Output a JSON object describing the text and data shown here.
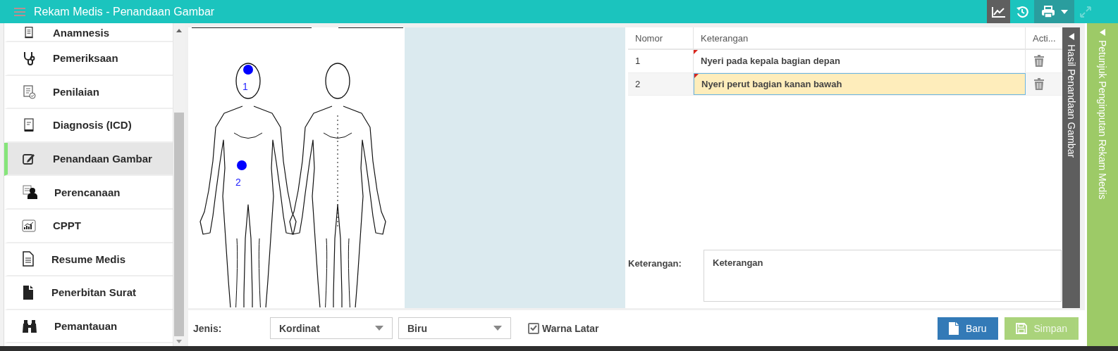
{
  "header": {
    "title": "Rekam Medis - Penandaan Gambar",
    "toolbar": [
      {
        "kind": "chart",
        "selected": true,
        "disabled": false
      },
      {
        "kind": "history",
        "selected": false,
        "disabled": false
      },
      {
        "kind": "print",
        "selected": false,
        "disabled": false
      },
      {
        "kind": "expand",
        "selected": false,
        "disabled": true
      }
    ]
  },
  "sidebar": {
    "items": [
      {
        "label": "Anamnesis",
        "selected": false
      },
      {
        "label": "Pemeriksaan",
        "selected": false
      },
      {
        "label": "Penilaian",
        "selected": false
      },
      {
        "label": "Diagnosis (ICD)",
        "selected": false
      },
      {
        "label": "Penandaan Gambar",
        "selected": true
      },
      {
        "label": "Perencanaan",
        "selected": false
      },
      {
        "label": "CPPT",
        "selected": false
      },
      {
        "label": "Resume Medis",
        "selected": false
      },
      {
        "label": "Penerbitan Surat",
        "selected": false
      },
      {
        "label": "Pemantauan",
        "selected": false
      }
    ]
  },
  "diagram": {
    "markers": [
      {
        "label": "1"
      },
      {
        "label": "2"
      }
    ]
  },
  "table": {
    "columns": [
      "Nomor",
      "Keterangan",
      "Acti..."
    ],
    "rows": [
      {
        "nomor": "1",
        "keterangan": "Nyeri pada kepala bagian depan",
        "modified": true,
        "selected": false
      },
      {
        "nomor": "2",
        "keterangan": "Nyeri perut bagian kanan bawah",
        "modified": true,
        "selected": true
      }
    ]
  },
  "note": {
    "label": "Keterangan:",
    "placeholder": "Keterangan"
  },
  "side_tabs": [
    {
      "label": "Hasil Penandaan Gambar",
      "kind": "dark"
    },
    {
      "label": "Petunjuk Penginputan Rekam Medis",
      "kind": "green"
    }
  ],
  "footer": {
    "type_label": "Jenis:",
    "selects": [
      {
        "value": "Kordinat"
      },
      {
        "value": "Biru"
      }
    ],
    "checkbox": {
      "label": "Warna Latar",
      "checked": true
    },
    "buttons": [
      {
        "label": "Baru",
        "kind": "primary",
        "disabled": false
      },
      {
        "label": "Simpan",
        "kind": "save",
        "disabled": true
      }
    ]
  }
}
